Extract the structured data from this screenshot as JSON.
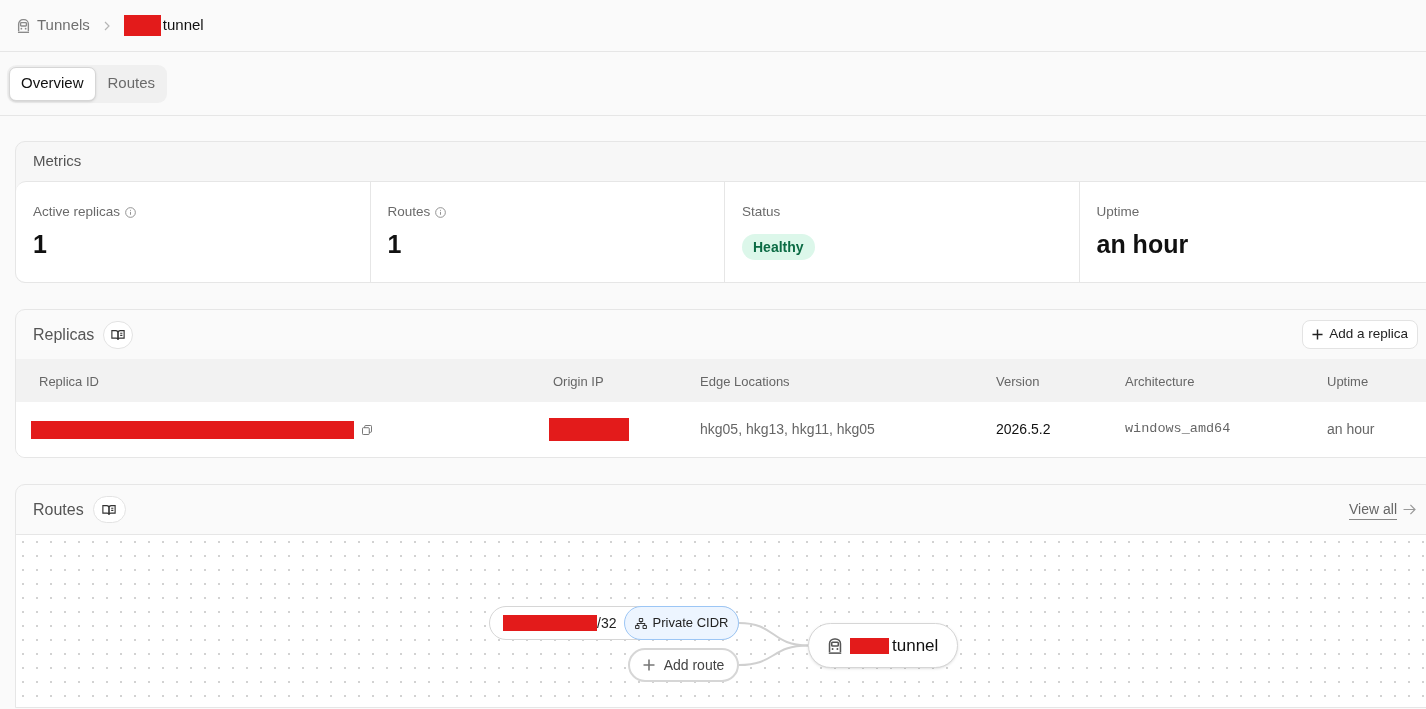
{
  "breadcrumb": [
    {
      "label": "Tunnels",
      "kind": "link",
      "redacted": false
    },
    {
      "label": "tunnel",
      "kind": "current",
      "redacted": true
    }
  ],
  "tabs": [
    {
      "label": "Overview",
      "selected": true
    },
    {
      "label": "Routes",
      "selected": false
    }
  ],
  "metrics": {
    "title": "Metrics",
    "items": [
      {
        "kind": "number",
        "label": "Active replicas",
        "info": true,
        "value": "1"
      },
      {
        "kind": "number",
        "label": "Routes",
        "info": true,
        "value": "1"
      },
      {
        "kind": "badge",
        "label": "Status",
        "info": false,
        "value": "Healthy"
      },
      {
        "kind": "number",
        "label": "Uptime",
        "info": false,
        "value": "an hour"
      }
    ]
  },
  "replicas": {
    "title": "Replicas",
    "action": "Add a replica",
    "columns": [
      "Replica ID",
      "Origin IP",
      "Edge Locations",
      "Version",
      "Architecture",
      "Uptime"
    ],
    "rows": [
      {
        "cells": [
          {
            "kind": "redacted",
            "copyable": true
          },
          {
            "kind": "redacted",
            "copyable": false
          },
          {
            "kind": "text",
            "text": "hkg05, hkg13, hkg11, hkg05"
          },
          {
            "kind": "strong",
            "text": "2026.5.2"
          },
          {
            "kind": "mono",
            "text": "windows_amd64"
          },
          {
            "kind": "text",
            "text": "an hour"
          }
        ]
      }
    ]
  },
  "routes": {
    "title": "Routes",
    "link": "View all",
    "diagram": {
      "routes": [
        {
          "redacted": true,
          "suffix": "/32",
          "type": "Private CIDR"
        }
      ],
      "add_route": "Add route",
      "tunnel": {
        "redacted": true,
        "label": "tunnel"
      }
    }
  }
}
